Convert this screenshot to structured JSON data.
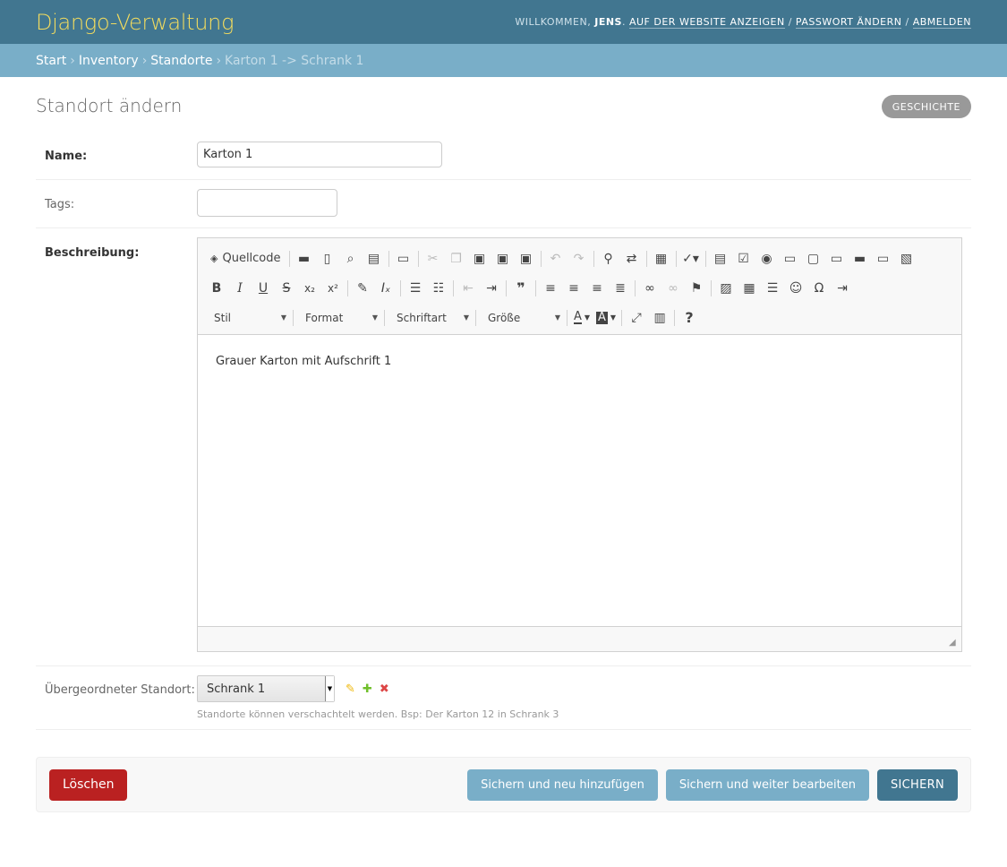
{
  "header": {
    "site_name": "Django-Verwaltung",
    "welcome": "WILLKOMMEN,",
    "username": "JENS",
    "view_site": "AUF DER WEBSITE ANZEIGEN",
    "change_password": "PASSWORT ÄNDERN",
    "logout": "ABMELDEN"
  },
  "breadcrumbs": {
    "home": "Start",
    "app": "Inventory",
    "model": "Standorte",
    "current": "Karton 1 -> Schrank 1"
  },
  "page": {
    "title": "Standort ändern",
    "history_button": "GESCHICHTE"
  },
  "form": {
    "name": {
      "label": "Name:",
      "value": "Karton 1"
    },
    "tags": {
      "label": "Tags:",
      "value": ""
    },
    "description": {
      "label": "Beschreibung:",
      "content": "Grauer Karton mit Aufschrift 1"
    },
    "parent": {
      "label": "Übergeordneter Standort:",
      "selected": "Schrank 1",
      "help": "Standorte können verschachtelt werden. Bsp: Der Karton 12 in Schrank 3"
    }
  },
  "editor": {
    "source_label": "Quellcode",
    "combos": {
      "style": "Stil",
      "format": "Format",
      "font": "Schriftart",
      "size": "Größe"
    }
  },
  "actions": {
    "delete": "Löschen",
    "save_add": "Sichern und neu hinzufügen",
    "save_continue": "Sichern und weiter bearbeiten",
    "save": "SICHERN"
  },
  "colors": {
    "header_bg": "#417690",
    "breadcrumbs_bg": "#79aec8",
    "site_name": "#f5dd5d",
    "delete": "#ba2121",
    "edit_icon": "#efb80b",
    "add_icon": "#70bf2b",
    "remove_icon": "#dd4646"
  }
}
